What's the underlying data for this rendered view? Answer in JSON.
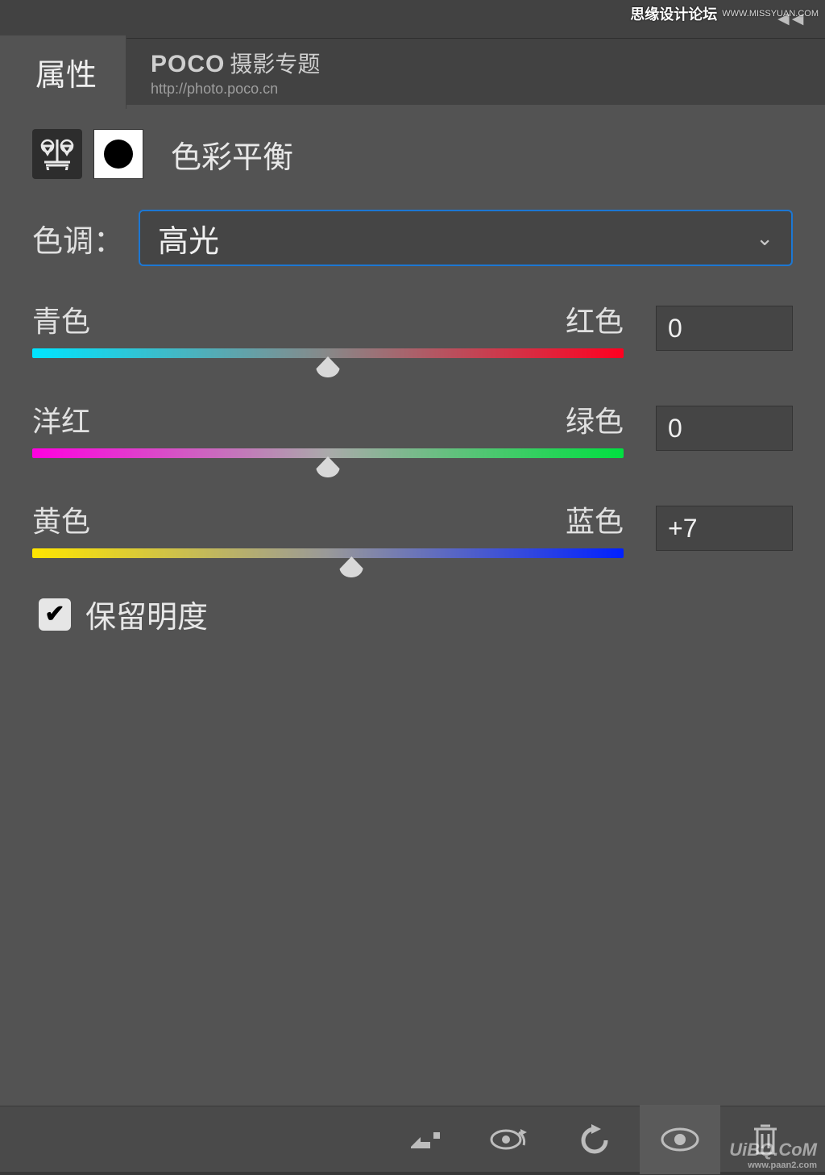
{
  "watermarks": {
    "top": "思缘设计论坛",
    "top_url": "WWW.MISSYUAN.COM",
    "bottom": "UiBQ.CoM",
    "bottom_sub": "www.paan2.com"
  },
  "tabs": {
    "active": "属性"
  },
  "brand": {
    "name": "POCO",
    "tagline": "摄影专题",
    "url": "http://photo.poco.cn"
  },
  "adjustment": {
    "title": "色彩平衡"
  },
  "tone": {
    "label": "色调：",
    "selected": "高光"
  },
  "sliders": {
    "cyan_red": {
      "left": "青色",
      "right": "红色",
      "value": "0",
      "pos": 50
    },
    "mag_green": {
      "left": "洋红",
      "right": "绿色",
      "value": "0",
      "pos": 50
    },
    "yel_blue": {
      "left": "黄色",
      "right": "蓝色",
      "value": "+7",
      "pos": 54
    }
  },
  "preserve_luminosity": {
    "label": "保留明度",
    "checked": true
  },
  "footer_icons": {
    "clip": "clip-to-layer-icon",
    "prev": "view-previous-icon",
    "reset": "reset-icon",
    "visibility": "visibility-icon",
    "trash": "trash-icon"
  }
}
